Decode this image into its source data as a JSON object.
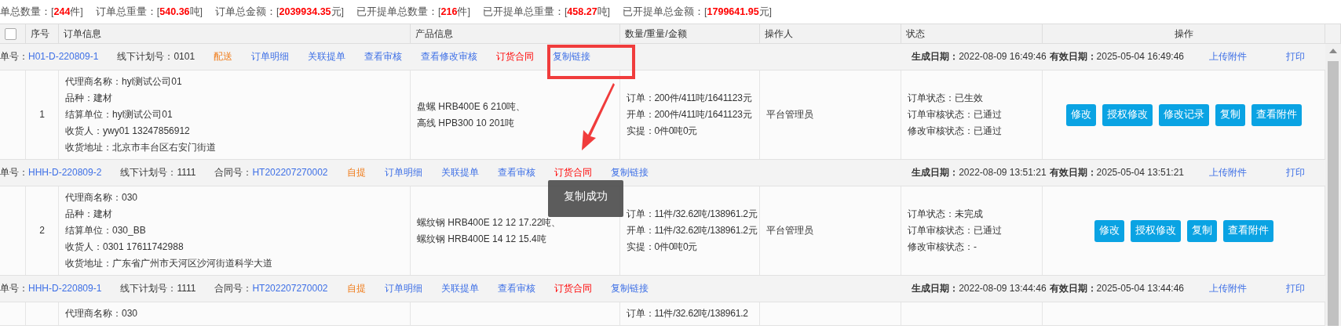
{
  "summary": [
    {
      "label": "单总数量：[",
      "value": "244",
      "unit": "件]"
    },
    {
      "label": "订单总重量：[",
      "value": "540.36",
      "unit": "吨]"
    },
    {
      "label": "订单总金额：[",
      "value": "2039934.35",
      "unit": "元]"
    },
    {
      "label": "已开提单总数量：[",
      "value": "216",
      "unit": "件]"
    },
    {
      "label": "已开提单总重量：[",
      "value": "458.27",
      "unit": "吨]"
    },
    {
      "label": "已开提单总金额：[",
      "value": "1799641.95",
      "unit": "元]"
    }
  ],
  "columns": [
    {
      "kind": "check",
      "checked": false
    },
    {
      "kind": "text",
      "label": "序号"
    },
    {
      "kind": "text",
      "label": "订单信息"
    },
    {
      "kind": "text",
      "label": "产品信息"
    },
    {
      "kind": "text",
      "label": "数量/重量/金额"
    },
    {
      "kind": "text",
      "label": "操作人"
    },
    {
      "kind": "text",
      "label": "状态"
    },
    {
      "kind": "center",
      "label": "操作"
    }
  ],
  "orders": [
    {
      "fields": [
        {
          "label": "单号：",
          "value": "H01-D-220809-1",
          "linked": true
        },
        {
          "label": "线下计划号：",
          "value": "0101",
          "linked": false
        }
      ],
      "links": [
        {
          "text": "配送",
          "kind": "mode"
        },
        {
          "text": "订单明细",
          "kind": "link"
        },
        {
          "text": "关联提单",
          "kind": "link"
        },
        {
          "text": "查看审核",
          "kind": "link"
        },
        {
          "text": "查看修改审核",
          "kind": "link"
        },
        {
          "text": "订货合同",
          "kind": "contract"
        },
        {
          "text": "复制链接",
          "kind": "link"
        }
      ],
      "dates": [
        "**生成日期：**2022-08-09 16:49:46",
        "**有效日期：**2025-05-04 16:49:46"
      ],
      "actions": [
        "上传附件",
        "打印"
      ],
      "index": "1",
      "info": [
        "代理商名称：hyl测试公司01",
        "品种：建材",
        "结算单位：hyl测试公司01",
        "收货人：ywy01 13247856912",
        "收货地址：北京市丰台区右安门街道"
      ],
      "products": [
        "盘螺 HRB400E 6 210吨、",
        "高线 HPB300 10 201吨"
      ],
      "quantity": [
        "订单：200件/411吨/1641123元",
        "开单：200件/411吨/1641123元",
        "实提：0件0吨0元"
      ],
      "operator": "平台管理员",
      "status": [
        "订单状态：已生效",
        "订单审核状态：已通过",
        "修改审核状态：已通过"
      ],
      "buttons": [
        "修改",
        "授权修改",
        "修改记录",
        "复制",
        "查看附件"
      ]
    },
    {
      "fields": [
        {
          "label": "单号：",
          "value": "HHH-D-220809-2",
          "linked": true
        },
        {
          "label": "线下计划号：",
          "value": "1111",
          "linked": false
        },
        {
          "label": "合同号：",
          "value": "HT202207270002",
          "linked": true
        }
      ],
      "links": [
        {
          "text": "自提",
          "kind": "mode"
        },
        {
          "text": "订单明细",
          "kind": "link"
        },
        {
          "text": "关联提单",
          "kind": "link"
        },
        {
          "text": "查看审核",
          "kind": "link"
        },
        {
          "text": "订货合同",
          "kind": "contract"
        },
        {
          "text": "复制链接",
          "kind": "link"
        }
      ],
      "dates": [
        "**生成日期：**2022-08-09 13:51:21",
        "**有效日期：**2025-05-04 13:51:21"
      ],
      "actions": [
        "上传附件",
        "打印"
      ],
      "index": "2",
      "info": [
        "代理商名称：030",
        "品种：建材",
        "结算单位：030_BB",
        "收货人：0301 17611742988",
        "收货地址：广东省广州市天河区沙河街道科学大道"
      ],
      "products": [
        "螺纹钢 HRB400E 12 12 17.22吨、",
        "螺纹钢 HRB400E 14 12 15.4吨"
      ],
      "quantity": [
        "订单：11件/32.62吨/138961.2元",
        "开单：11件/32.62吨/138961.2元",
        "实提：0件0吨0元"
      ],
      "operator": "平台管理员",
      "status": [
        "订单状态：未完成",
        "订单审核状态：已通过",
        "修改审核状态：-"
      ],
      "buttons": [
        "修改",
        "授权修改",
        "复制",
        "查看附件"
      ]
    },
    {
      "fields": [
        {
          "label": "单号：",
          "value": "HHH-D-220809-1",
          "linked": true
        },
        {
          "label": "线下计划号：",
          "value": "1111",
          "linked": false
        },
        {
          "label": "合同号：",
          "value": "HT202207270002",
          "linked": true
        }
      ],
      "links": [
        {
          "text": "自提",
          "kind": "mode"
        },
        {
          "text": "订单明细",
          "kind": "link"
        },
        {
          "text": "关联提单",
          "kind": "link"
        },
        {
          "text": "查看审核",
          "kind": "link"
        },
        {
          "text": "订货合同",
          "kind": "contract"
        },
        {
          "text": "复制链接",
          "kind": "link"
        }
      ],
      "dates": [
        "**生成日期：**2022-08-09 13:44:46",
        "**有效日期：**2025-05-04 13:44:46"
      ],
      "actions": [
        "上传附件",
        "打印"
      ],
      "info": [
        "代理商名称：030"
      ],
      "quantity": [
        "订单：11件/32.62吨/138961.2"
      ]
    }
  ],
  "toast": "复制成功"
}
